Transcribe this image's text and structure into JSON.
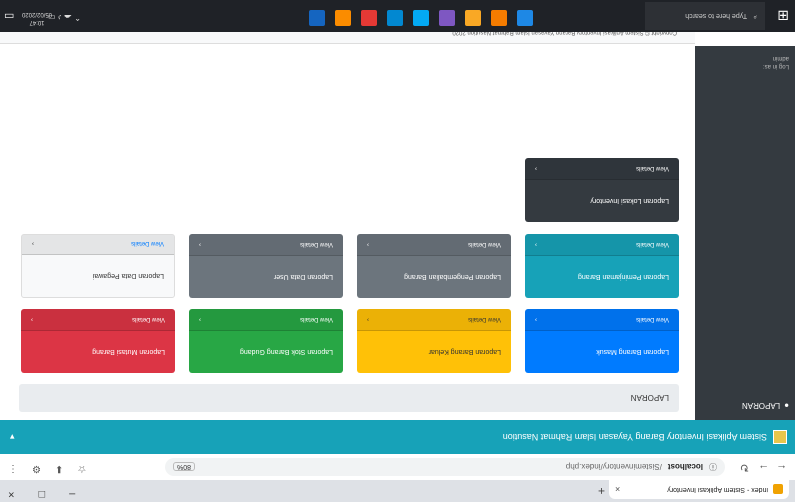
{
  "browser": {
    "tab_title": "index - Sistem Aplikasi Inventory",
    "tab_close": "×",
    "new_tab": "+",
    "window_controls": [
      "–",
      "□",
      "×"
    ],
    "nav": {
      "back": "←",
      "forward": "→",
      "reload": "↻"
    },
    "url_host": "localhost",
    "url_path": "/Sisteminventory/index.php",
    "zoom_label": "80%",
    "right_icons": [
      "☆",
      "⬇",
      "⚙",
      "⋮"
    ]
  },
  "app": {
    "brand": "Sistem Aplikasi Inventory Barang Yayasan Islam Rahmat Nasution",
    "user_menu": "▾",
    "sidebar": {
      "item_label": "LAPORAN",
      "footer_line1": "Log in as:",
      "footer_line2": "admin"
    },
    "breadcrumb": "LAPORAN",
    "cards": [
      {
        "title": "Laporan Barang Masuk",
        "footer": "View Details",
        "arrow": "›"
      },
      {
        "title": "Laporan Barang Keluar",
        "footer": "View Details",
        "arrow": "›"
      },
      {
        "title": "Laporan Stok Barang Gudang",
        "footer": "View Details",
        "arrow": "›"
      },
      {
        "title": "Laporan Mutasi Barang",
        "footer": "View Details",
        "arrow": "›"
      },
      {
        "title": "Laporan Peminjaman Barang",
        "footer": "View Details",
        "arrow": "›"
      },
      {
        "title": "Laporan Pengembalian Barang",
        "footer": "View Details",
        "arrow": "›"
      },
      {
        "title": "Laporan Data User",
        "footer": "View Details",
        "arrow": "›"
      },
      {
        "title": "Laporan Data Pegawai",
        "footer": "View Details",
        "arrow": "›"
      },
      {
        "title": "Laporan Lokasi Inventory",
        "footer": "View Details",
        "arrow": "›"
      }
    ],
    "copyright": "Copyright © Sistem Aplikasi Inventory Barang Yayasan Islam Rahmat Nasution 2020"
  },
  "taskbar": {
    "start": "⊞",
    "search_placeholder": "Type here to search",
    "tray": "⌃ ☁ ♪ ▭",
    "time": "10:47",
    "date": "05/02/2020",
    "notif": "▭"
  },
  "colors": {
    "topbar": "#17a2b8",
    "sidebar": "#343a40",
    "primary": "#007bff",
    "warning": "#ffc107",
    "success": "#28a745",
    "danger": "#dc3545",
    "info": "#17a2b8",
    "secondary": "#6c757d",
    "dark": "#343a40"
  }
}
